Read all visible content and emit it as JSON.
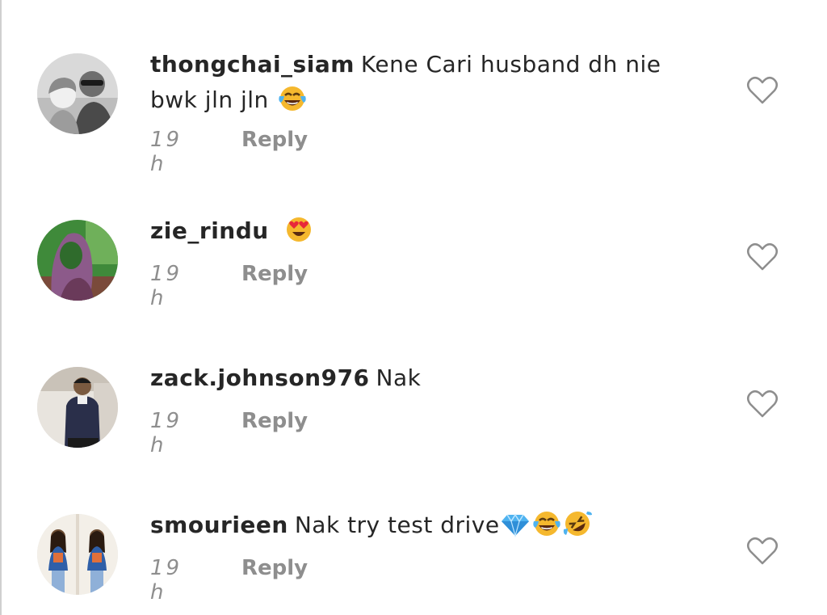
{
  "comments": [
    {
      "username": "thongchai_siam",
      "text_line1": "Kene Cari husband dh nie",
      "text_line2": "bwk jln jln",
      "time": "19 h",
      "reply_label": "Reply",
      "emojis": [
        "face-with-tears-of-joy"
      ],
      "like_icon": "heart-outline-icon"
    },
    {
      "username": "zie_rindu",
      "text_line1": "",
      "time": "19 h",
      "reply_label": "Reply",
      "emojis": [
        "smiling-face-with-heart-eyes"
      ],
      "like_icon": "heart-outline-icon"
    },
    {
      "username": "zack.johnson976",
      "text_line1": "Nak",
      "time": "19 h",
      "reply_label": "Reply",
      "emojis": [],
      "like_icon": "heart-outline-icon"
    },
    {
      "username": "smourieen",
      "text_line1": "Nak try test drive",
      "time": "19 h",
      "reply_label": "Reply",
      "emojis": [
        "gem-stone",
        "face-with-tears-of-joy",
        "rolling-on-the-floor-laughing"
      ],
      "like_icon": "heart-outline-icon"
    }
  ],
  "colors": {
    "text": "#262626",
    "secondary": "#8e8e8e",
    "emoji_yellow": "#f5b82e",
    "gem_blue": "#4fb3f0"
  }
}
